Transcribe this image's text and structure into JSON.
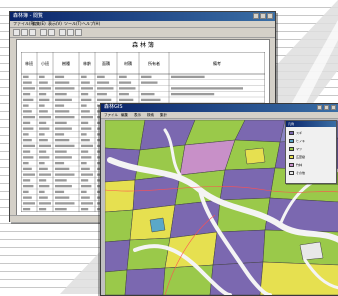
{
  "ledger_window": {
    "title": "森林簿 - 閲覧",
    "menu": [
      "ファイル(F)",
      "編集(E)",
      "表示(V)",
      "ツール(T)",
      "ヘルプ(H)"
    ],
    "document_title": "森 林 簿",
    "table_headers": [
      "林班",
      "小班",
      "樹種",
      "林齢",
      "面積",
      "材積",
      "所有者",
      "備考"
    ],
    "row_count": 24
  },
  "map_window": {
    "title": "森林GIS",
    "menu": [
      "ファイル",
      "編集",
      "表示",
      "検索",
      "集計"
    ],
    "legend": {
      "title": "凡例",
      "items": [
        {
          "label": "スギ",
          "color": "#7b68b0"
        },
        {
          "label": "ヒノキ",
          "color": "#5aa8c8"
        },
        {
          "label": "マツ",
          "color": "#9ac94a"
        },
        {
          "label": "広葉樹",
          "color": "#e6e050"
        },
        {
          "label": "竹林",
          "color": "#c890c8"
        },
        {
          "label": "その他",
          "color": "#e8e8e8"
        }
      ]
    }
  }
}
